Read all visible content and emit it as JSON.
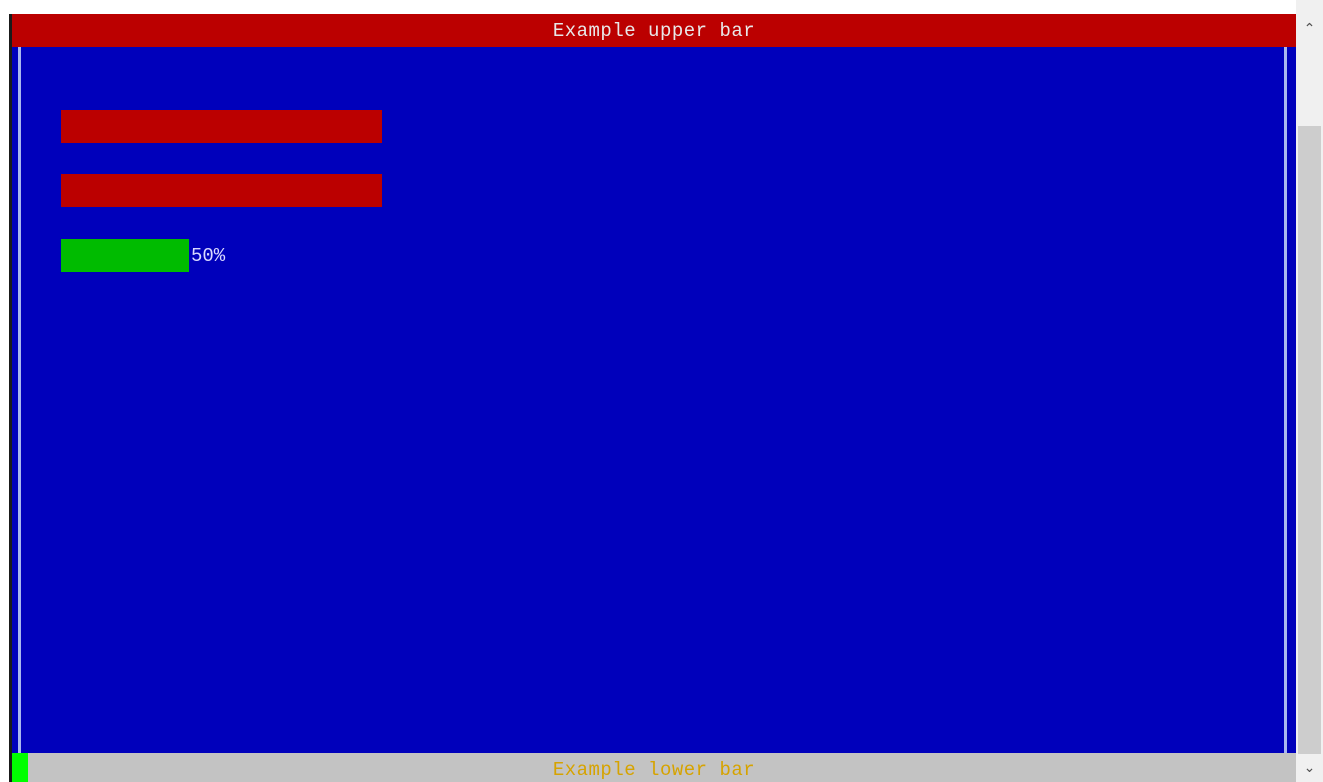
{
  "terminal": {
    "upper_bar_text": "Example upper bar",
    "lower_bar_text": "Example lower bar",
    "progress": {
      "value_percent": 50,
      "label": "50%"
    },
    "colors": {
      "background": "#0000bb",
      "upper_bar": "#bb0000",
      "field": "#bb0000",
      "progress_fill": "#00bb00",
      "lower_bar": "#c3c3c3",
      "lower_bar_text": "#d6a300",
      "cursor": "#00ff00"
    }
  },
  "scrollbar": {
    "up_icon": "chevron-up-icon",
    "down_icon": "chevron-down-icon"
  }
}
